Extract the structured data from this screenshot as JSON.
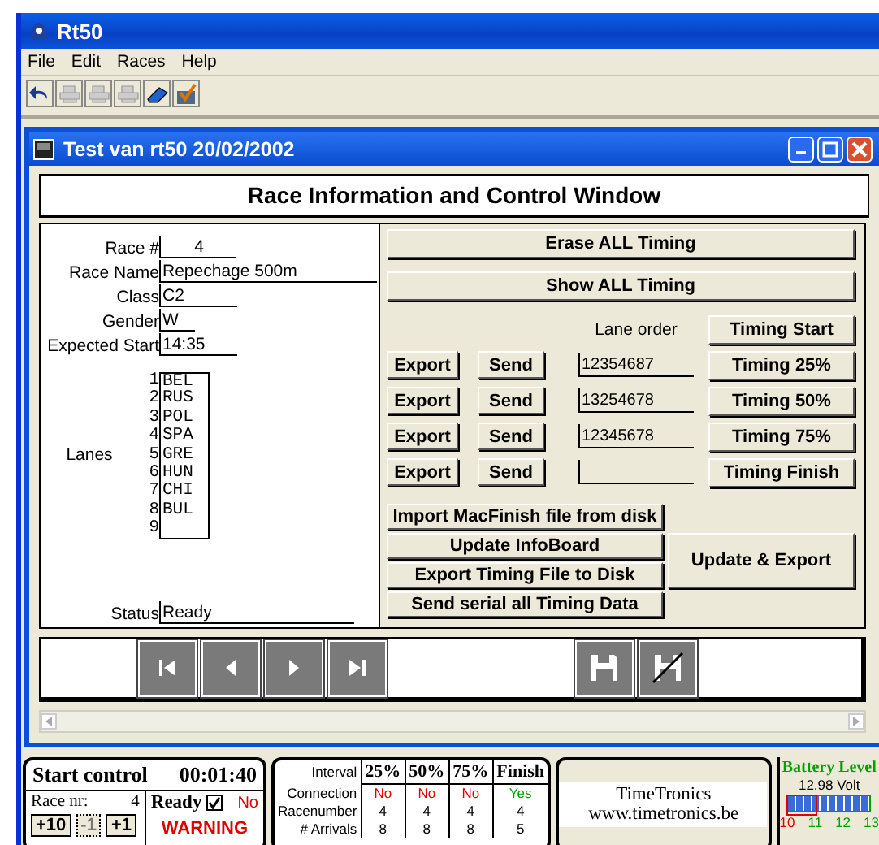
{
  "app": {
    "title": "Rt50",
    "menu": [
      "File",
      "Edit",
      "Races",
      "Help"
    ]
  },
  "window": {
    "title": "Test van rt50 20/02/2002",
    "heading": "Race Information and Control Window"
  },
  "race": {
    "fields": [
      {
        "label": "Race #",
        "value": "4",
        "kind": "number"
      },
      {
        "label": "Race Name",
        "value": "Repechage 500m",
        "kind": "wide"
      },
      {
        "label": "Class",
        "value": "C2",
        "kind": "medium"
      },
      {
        "label": "Gender",
        "value": "W",
        "kind": "short"
      },
      {
        "label": "Expected Start",
        "value": "14:35",
        "kind": "medium"
      }
    ],
    "lanes_label": "Lanes",
    "lanes": [
      {
        "number": "1",
        "team": "BEL"
      },
      {
        "number": "2",
        "team": "RUS"
      },
      {
        "number": "3",
        "team": "POL"
      },
      {
        "number": "4",
        "team": "SPA"
      },
      {
        "number": "5",
        "team": "GRE"
      },
      {
        "number": "6",
        "team": "HUN"
      },
      {
        "number": "7",
        "team": "CHI"
      },
      {
        "number": "8",
        "team": "BUL"
      },
      {
        "number": "9"
      }
    ],
    "status": {
      "label": "Status",
      "value": "Ready"
    }
  },
  "controls": {
    "erase": "Erase ALL Timing",
    "show": "Show ALL Timing",
    "lane_order_label": "Lane order",
    "timing_start": "Timing Start",
    "rows": [
      {
        "export": "Export",
        "send": "Send",
        "lane_order": "12354687",
        "timing": "Timing 25%"
      },
      {
        "export": "Export",
        "send": "Send",
        "lane_order": "13254678",
        "timing": "Timing 50%"
      },
      {
        "export": "Export",
        "send": "Send",
        "lane_order": "12345678",
        "timing": "Timing 75%"
      },
      {
        "export": "Export",
        "send": "Send",
        "timing": "Timing Finish"
      }
    ],
    "actions": [
      "Import MacFinish file from disk",
      "Update InfoBoard",
      "Export Timing File to Disk",
      "Send serial all Timing Data"
    ],
    "update_export": "Update & Export"
  },
  "status_bar": {
    "start_control": {
      "title": "Start control",
      "time": "00:01:40",
      "race_label": "Race nr:",
      "race_number": "4",
      "ready_label": "Ready",
      "ready_checked": true,
      "ready_state": "No",
      "warning": "WARNING",
      "buttons": [
        {
          "label": "+10",
          "disabled": false
        },
        {
          "label": "-1",
          "disabled": true
        },
        {
          "label": "+1",
          "disabled": false
        }
      ]
    },
    "intervals": {
      "row_labels": [
        "Interval",
        "Connection",
        "Racenumber",
        "# Arrivals"
      ],
      "columns": [
        {
          "name": "25%",
          "connection": "No",
          "connected": false,
          "racenumber": "4",
          "arrivals": "8"
        },
        {
          "name": "50%",
          "connection": "No",
          "connected": false,
          "racenumber": "4",
          "arrivals": "8"
        },
        {
          "name": "75%",
          "connection": "No",
          "connected": false,
          "racenumber": "4",
          "arrivals": "8"
        },
        {
          "name": "Finish",
          "connection": "Yes",
          "connected": true,
          "racenumber": "4",
          "arrivals": "5"
        }
      ]
    },
    "brand": {
      "name": "TimeTronics",
      "url": "www.timetronics.be"
    },
    "battery": {
      "title": "Battery Level",
      "reading": "12.98 Volt",
      "level": 0.99,
      "scale": [
        "10",
        "11",
        "12",
        "13"
      ]
    }
  }
}
